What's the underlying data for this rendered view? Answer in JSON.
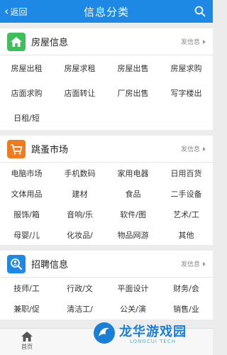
{
  "header": {
    "back_label": "返回",
    "title": "信息分类"
  },
  "sections": [
    {
      "title": "房屋信息",
      "post_label": "发信息",
      "icon": "house-icon",
      "icon_color": "#3fbf5a",
      "items": [
        "房屋出租",
        "房屋求租",
        "房屋出售",
        "房屋求购",
        "店面求购",
        "店面转让",
        "厂房出售",
        "写字楼出",
        "日租/短"
      ]
    },
    {
      "title": "跳蚤市场",
      "post_label": "发信息",
      "icon": "cart-icon",
      "icon_color": "#f07a1e",
      "items": [
        "电脑市场",
        "手机数码",
        "家用电器",
        "日用百货",
        "文体用品",
        "建材",
        "食品",
        "二手设备",
        "服饰/箱",
        "音响/乐",
        "软件/图",
        "艺术/工",
        "母婴/儿",
        "化妆品/",
        "物品网游",
        "其他"
      ]
    },
    {
      "title": "招聘信息",
      "post_label": "发信息",
      "icon": "person-search-icon",
      "icon_color": "#1e88e5",
      "items": [
        "技师/工",
        "行政/文",
        "平面设计",
        "财务/会",
        "兼职/促",
        "清洁工/",
        "公关/演",
        "销售/业"
      ]
    }
  ],
  "tabbar": {
    "home_label": "首页"
  },
  "watermark": {
    "cn": "龙华游戏园",
    "en": "LONGCUI TECH"
  },
  "colors": {
    "header": "#1e88e5",
    "brand_text": "#1a7fd6"
  }
}
